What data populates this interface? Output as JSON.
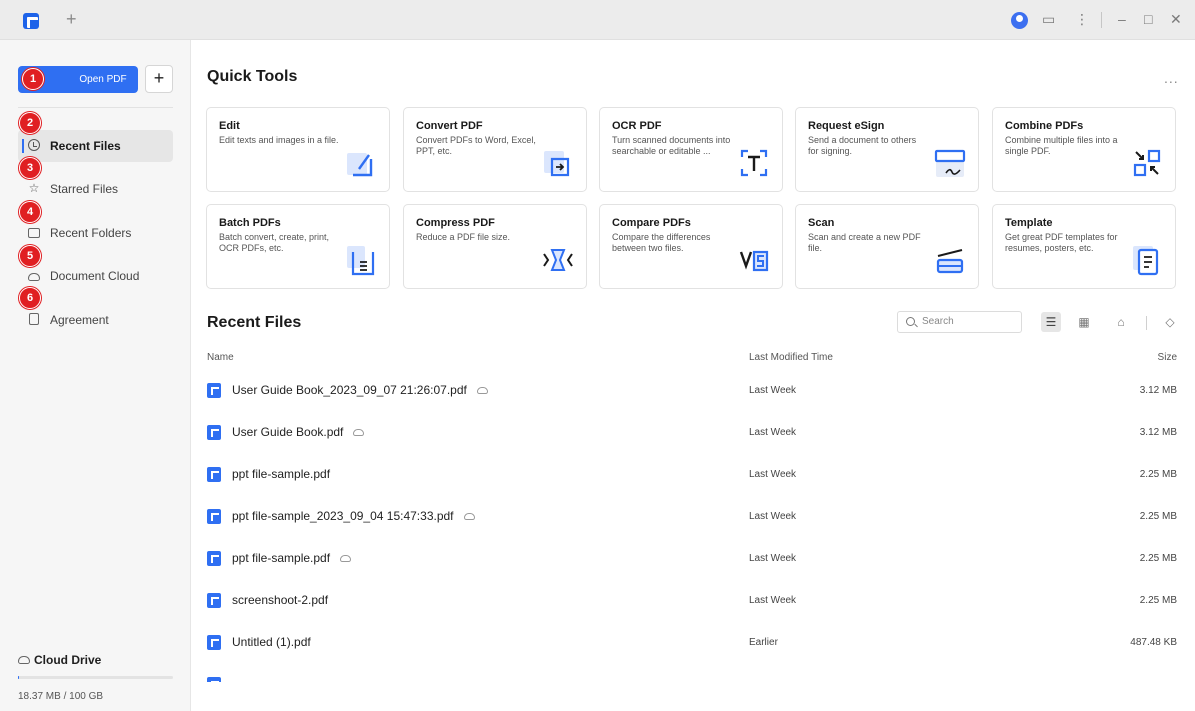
{
  "titlebar": {
    "new_tab": "+",
    "chat": "▭",
    "more": "⋮",
    "minimize": "–",
    "maximize": "□",
    "close": "✕"
  },
  "sidebar": {
    "open_pdf": "Open PDF",
    "add": "+",
    "items": [
      {
        "label": "Recent Files",
        "badge": "2",
        "icon": "clock-icon"
      },
      {
        "label": "Starred Files",
        "badge": "3",
        "icon": "star-icon"
      },
      {
        "label": "Recent Folders",
        "badge": "4",
        "icon": "folder-icon"
      },
      {
        "label": "Document Cloud",
        "badge": "5",
        "icon": "cloud-icon"
      },
      {
        "label": "Agreement",
        "badge": "6",
        "icon": "agreement-icon"
      }
    ],
    "open_badge": "1",
    "cloud_drive": "Cloud Drive",
    "storage": "18.37 MB / 100 GB",
    "storage_fraction": 0.0002
  },
  "quick_tools": {
    "title": "Quick Tools",
    "more": "...",
    "tools": [
      {
        "name": "Edit",
        "desc": "Edit texts and images in a file."
      },
      {
        "name": "Convert PDF",
        "desc": "Convert PDFs to Word, Excel, PPT, etc."
      },
      {
        "name": "OCR PDF",
        "desc": "Turn scanned documents into searchable or editable ..."
      },
      {
        "name": "Request eSign",
        "desc": "Send a document to others for signing."
      },
      {
        "name": "Combine PDFs",
        "desc": "Combine multiple files into a single PDF."
      },
      {
        "name": "Batch PDFs",
        "desc": "Batch convert, create, print, OCR PDFs, etc."
      },
      {
        "name": "Compress PDF",
        "desc": "Reduce a PDF file size."
      },
      {
        "name": "Compare PDFs",
        "desc": "Compare the differences between two files."
      },
      {
        "name": "Scan",
        "desc": "Scan and create a new PDF file."
      },
      {
        "name": "Template",
        "desc": "Get great PDF templates for resumes, posters, etc."
      }
    ]
  },
  "recent_files": {
    "title": "Recent Files",
    "search_placeholder": "Search",
    "columns": {
      "name": "Name",
      "time": "Last Modified Time",
      "size": "Size"
    },
    "files": [
      {
        "name": "User Guide Book_2023_09_07 21:26:07.pdf",
        "cloud": true,
        "time": "Last Week",
        "size": "3.12 MB"
      },
      {
        "name": "User Guide Book.pdf",
        "cloud": true,
        "time": "Last Week",
        "size": "3.12 MB"
      },
      {
        "name": "ppt file-sample.pdf",
        "cloud": false,
        "time": "Last Week",
        "size": "2.25 MB"
      },
      {
        "name": "ppt file-sample_2023_09_04 15:47:33.pdf",
        "cloud": true,
        "time": "Last Week",
        "size": "2.25 MB"
      },
      {
        "name": "ppt file-sample.pdf",
        "cloud": true,
        "time": "Last Week",
        "size": "2.25 MB"
      },
      {
        "name": "screenshoot-2.pdf",
        "cloud": false,
        "time": "Last Week",
        "size": "2.25 MB"
      },
      {
        "name": "Untitled (1).pdf",
        "cloud": false,
        "time": "Earlier",
        "size": "487.48 KB"
      }
    ]
  },
  "colors": {
    "accent": "#2f6ff2",
    "badge": "#e01f22"
  }
}
